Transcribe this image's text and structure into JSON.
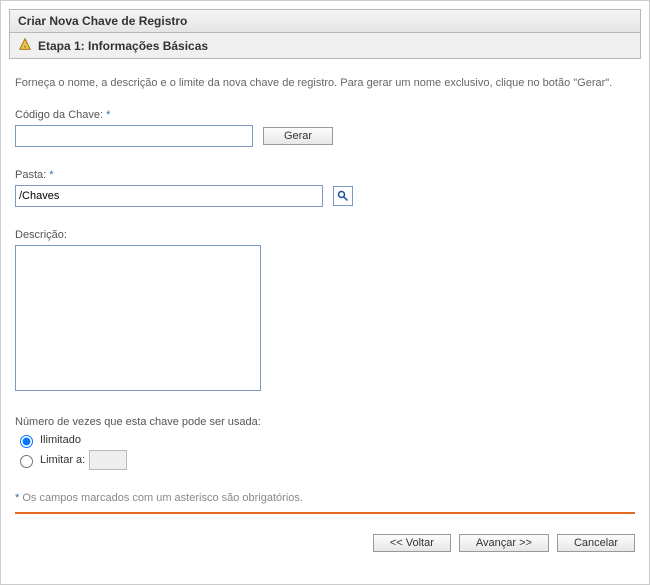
{
  "panel": {
    "title": "Criar Nova Chave de Registro",
    "subtitle": "Etapa 1: Informações Básicas"
  },
  "description": "Forneça o nome, a descrição e o limite da nova chave de registro. Para gerar um nome exclusivo, clique no botão \"Gerar\".",
  "fields": {
    "code": {
      "label": "Código da Chave:",
      "value": "",
      "required_mark": "*"
    },
    "generate_label": "Gerar",
    "folder": {
      "label": "Pasta:",
      "value": "/Chaves",
      "required_mark": "*"
    },
    "desc": {
      "label": "Descrição:",
      "value": ""
    },
    "usage": {
      "label": "Número de vezes que esta chave pode ser usada:",
      "unlimited_label": "Ilimitado",
      "limit_label": "Limitar a:",
      "selected": "unlimited",
      "limit_value": ""
    }
  },
  "footnote": {
    "mark": "*",
    "text": "Os campos marcados com um asterisco são obrigatórios."
  },
  "buttons": {
    "back": "<< Voltar",
    "next": "Avançar >>",
    "cancel": "Cancelar"
  }
}
